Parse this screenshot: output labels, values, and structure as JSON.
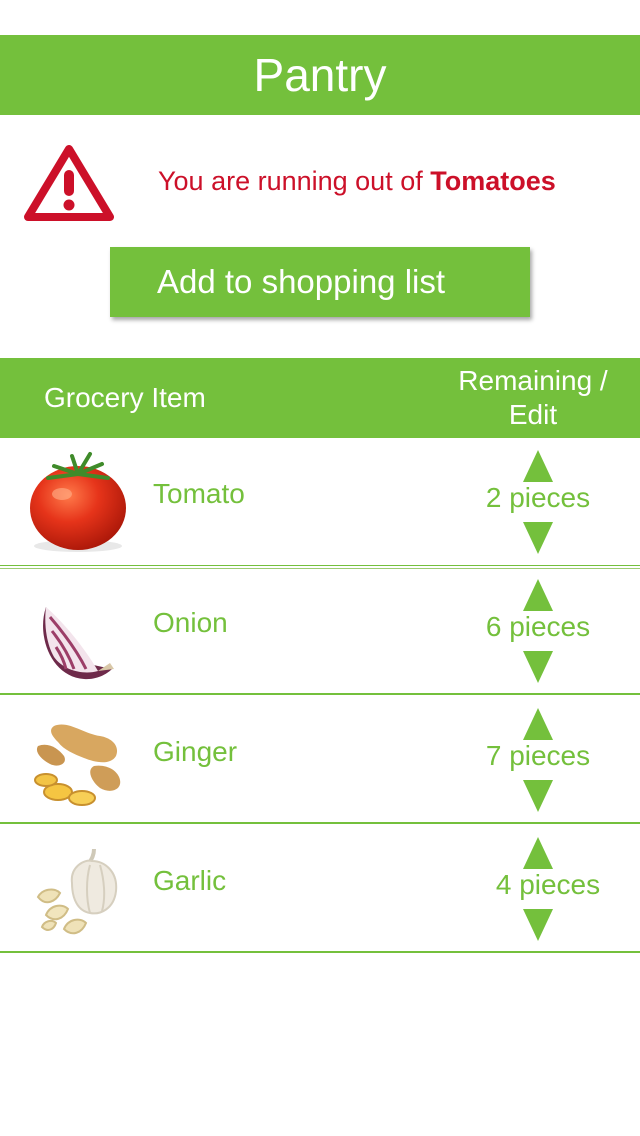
{
  "app": {
    "title": "Pantry"
  },
  "alert": {
    "icon": "warning-triangle-icon",
    "prefix": "You are running out of",
    "item": "Tomatoes"
  },
  "actions": {
    "add_to_shopping_list": "Add to shopping list"
  },
  "table": {
    "headers": {
      "item": "Grocery Item",
      "remaining": "Remaining / Edit"
    },
    "rows": [
      {
        "name": "Tomato",
        "quantity": "2 pieces",
        "icon": "tomato-image"
      },
      {
        "name": "Onion",
        "quantity": "6 pieces",
        "icon": "onion-image"
      },
      {
        "name": "Ginger",
        "quantity": "7 pieces",
        "icon": "ginger-image"
      },
      {
        "name": "Garlic",
        "quantity": "4 pieces",
        "icon": "garlic-image"
      }
    ]
  },
  "colors": {
    "accent": "#74c03c",
    "alert": "#cc1029"
  }
}
